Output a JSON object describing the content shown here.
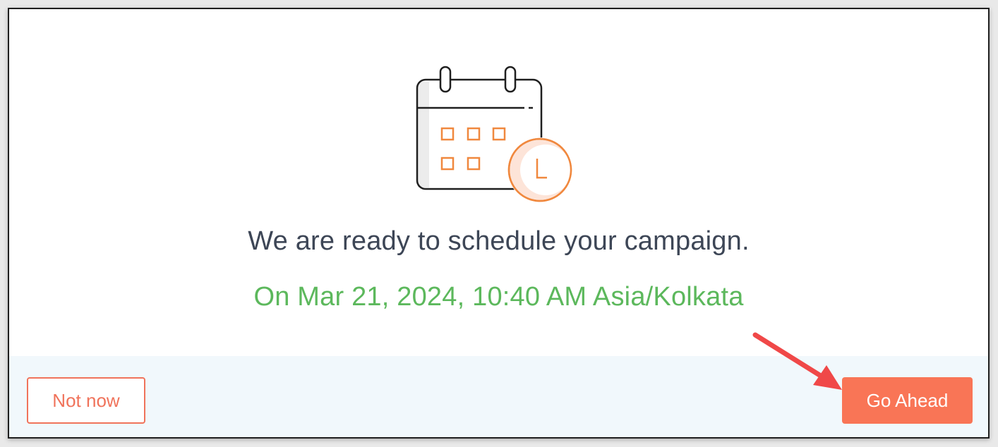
{
  "dialog": {
    "headline": "We are ready to schedule your campaign.",
    "schedule_text": "On Mar 21, 2024, 10:40 AM Asia/Kolkata"
  },
  "illustration": {
    "icon": "calendar-clock-icon",
    "accent_color": "#f0883e",
    "outline_color": "#1f1f1f"
  },
  "footer": {
    "not_now_label": "Not now",
    "go_ahead_label": "Go Ahead"
  },
  "annotation": {
    "icon": "red-arrow-icon",
    "color": "#f04848"
  },
  "colors": {
    "headline": "#3d4656",
    "schedule": "#5cb85c",
    "primary_button": "#f97556",
    "footer_background": "#f1f8fc"
  }
}
